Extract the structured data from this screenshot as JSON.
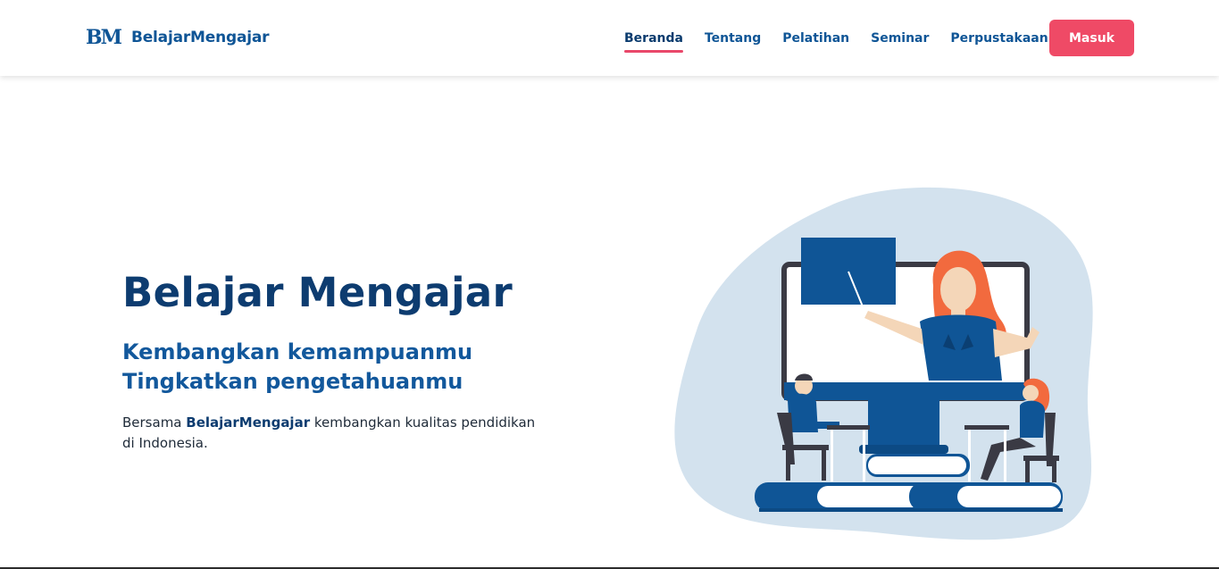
{
  "brand": {
    "logo_mark": "BM",
    "name": "BelajarMengajar"
  },
  "nav": {
    "items": [
      {
        "label": "Beranda",
        "active": true
      },
      {
        "label": "Tentang",
        "active": false
      },
      {
        "label": "Pelatihan",
        "active": false
      },
      {
        "label": "Seminar",
        "active": false
      },
      {
        "label": "Perpustakaan",
        "active": false
      }
    ],
    "login_label": "Masuk"
  },
  "hero": {
    "title": "Belajar Mengajar",
    "subtitle_line1": "Kembangkan kemampuanmu",
    "subtitle_line2": "Tingkatkan pengetahuanmu",
    "desc_prefix": "Bersama ",
    "desc_brand": "BelajarMengajar",
    "desc_suffix": " kembangkan kualitas pendidikan di Indonesia."
  },
  "colors": {
    "primary": "#0f5596",
    "heading": "#0d3c70",
    "accent": "#ef4a66",
    "blob": "#d3e2ee"
  },
  "illustration": {
    "icon": "online-teaching-illustration"
  }
}
